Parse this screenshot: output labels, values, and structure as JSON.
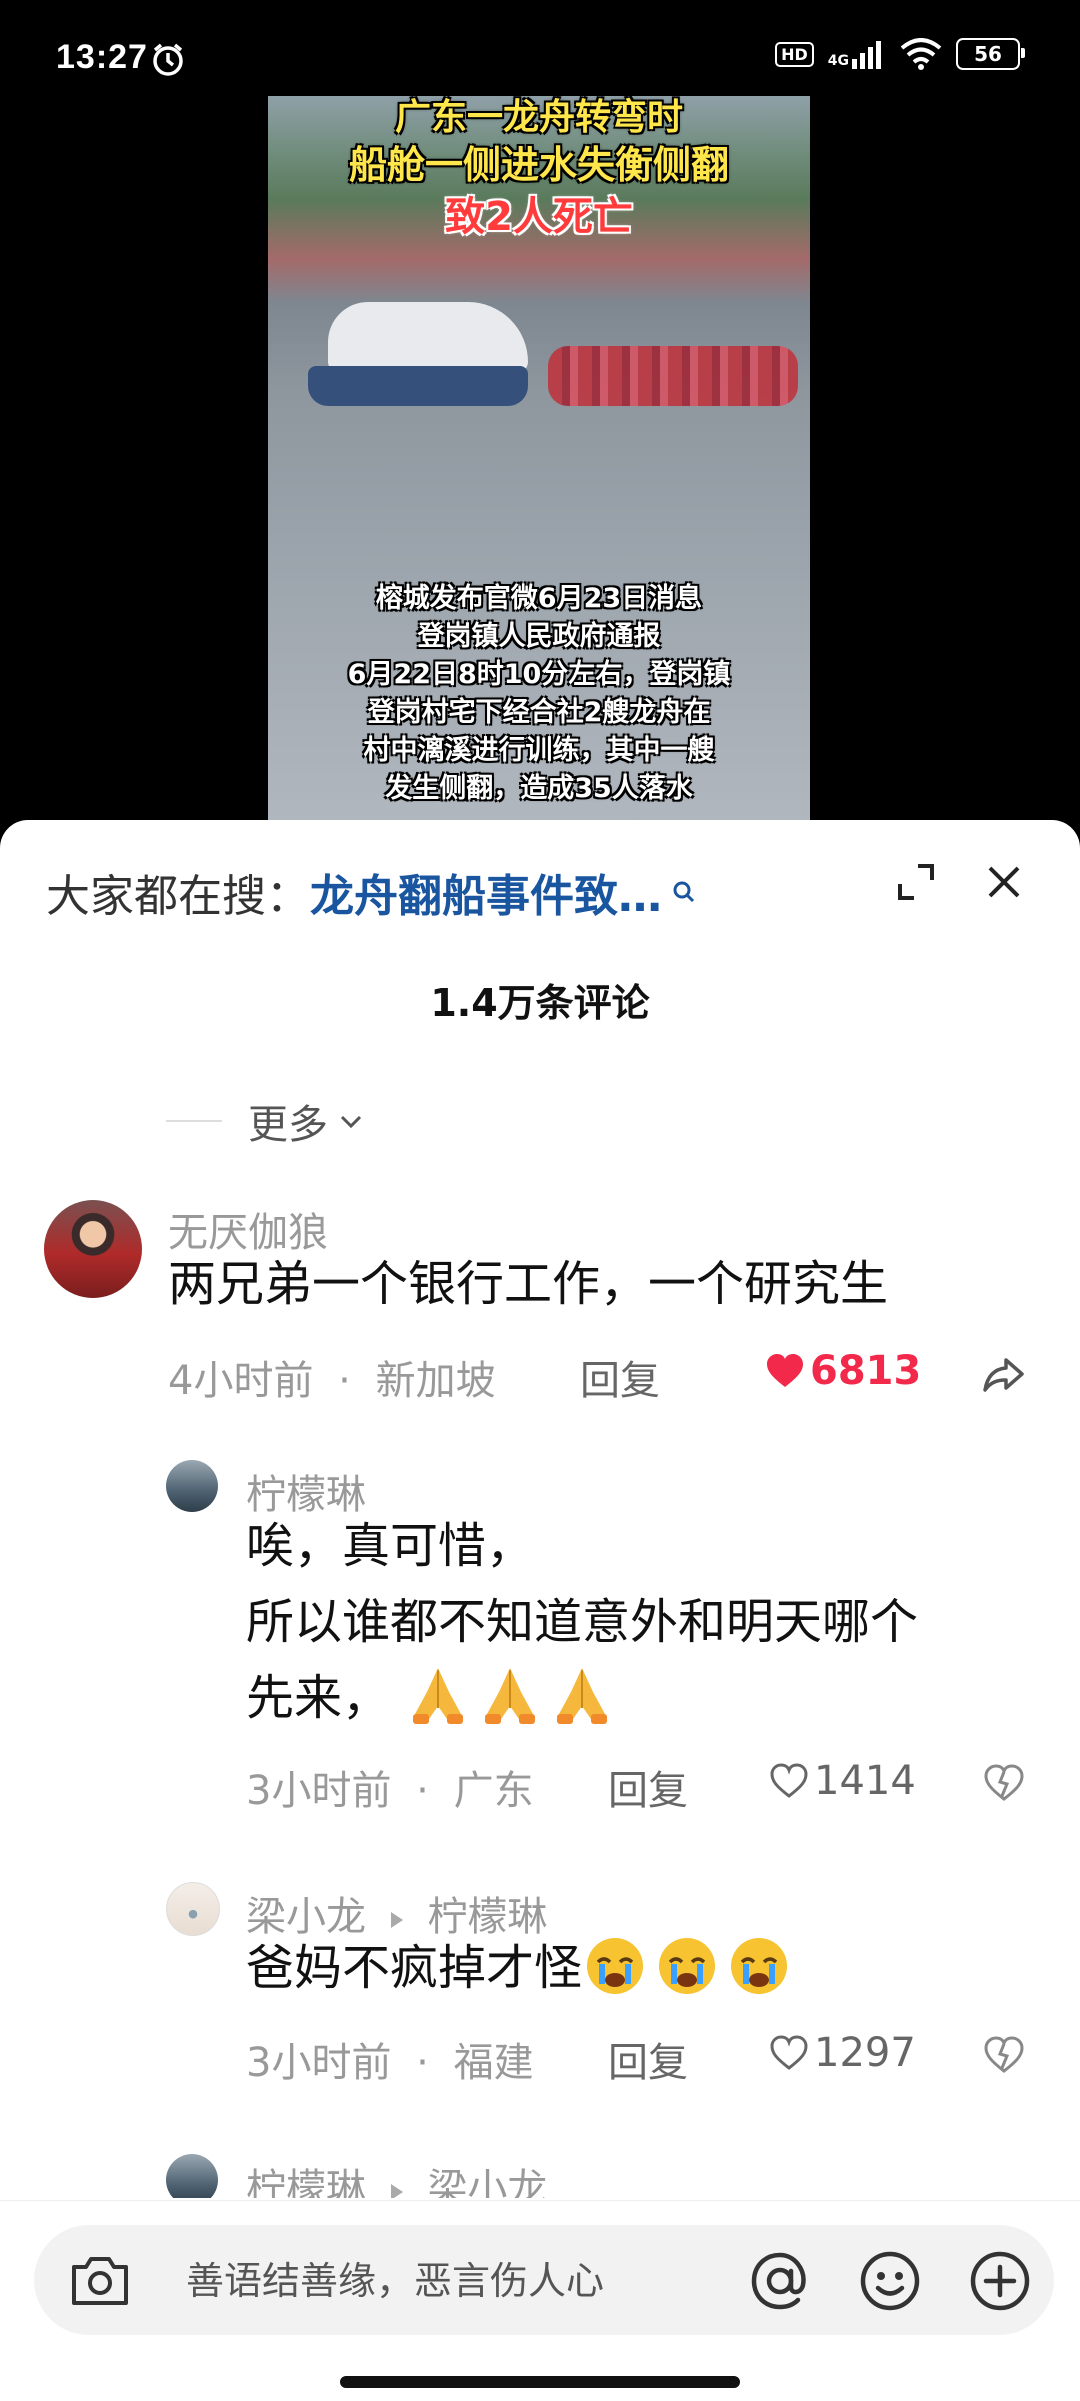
{
  "status_bar": {
    "time": "13:27",
    "hd": "HD",
    "network": "4G",
    "battery": "56"
  },
  "video": {
    "title_line1": "广东一龙舟转弯时",
    "title_line2": "船舱一侧进水失衡侧翻",
    "title_line3": "致2人死亡",
    "caption_lines": [
      "榕城发布官微6月23日消息",
      "登岗镇人民政府通报",
      "6月22日8时10分左右，登岗镇",
      "登岗村宅下经合社2艘龙舟在",
      "村中漓溪进行训练，其中一艘",
      "发生侧翻，造成35人落水"
    ]
  },
  "search": {
    "prefix": "大家都在搜：",
    "query": "龙舟翻船事件致…"
  },
  "comments_header": {
    "count_label": "1.4万条评论"
  },
  "more": {
    "label": "更多"
  },
  "comments": [
    {
      "username": "无厌伽狼",
      "text": "两兄弟一个银行工作，一个研究生",
      "time": "4小时前",
      "location": "新加坡",
      "reply": "回复",
      "likes": "6813"
    },
    {
      "username": "柠檬琳",
      "text_line1": "唉，真可惜，",
      "text_line2": "所以谁都不知道意外和明天哪个",
      "text_line3": "先来，",
      "time": "3小时前",
      "location": "广东",
      "reply": "回复",
      "likes": "1414"
    },
    {
      "username": "梁小龙",
      "reply_to": "柠檬琳",
      "text": "爸妈不疯掉才怪",
      "time": "3小时前",
      "location": "福建",
      "reply": "回复",
      "likes": "1297"
    },
    {
      "username": "柠檬琳",
      "reply_to": "梁小龙"
    }
  ],
  "separator": "·",
  "input": {
    "placeholder": "善语结善缘，恶言伤人心"
  },
  "colors": {
    "link": "#1a55a0",
    "like_red": "#f2294a"
  }
}
